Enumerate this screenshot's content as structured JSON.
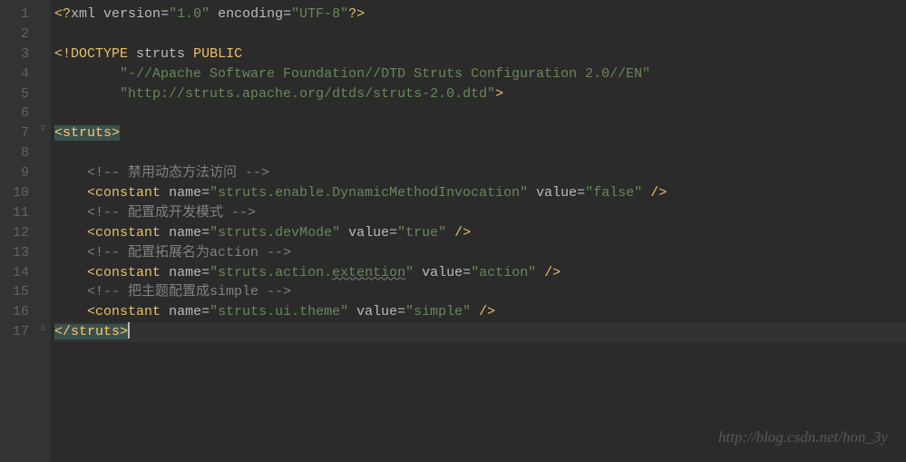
{
  "gutter": {
    "lines": [
      "1",
      "2",
      "3",
      "4",
      "5",
      "6",
      "7",
      "8",
      "9",
      "10",
      "11",
      "12",
      "13",
      "14",
      "15",
      "16",
      "17"
    ]
  },
  "code": {
    "line1": {
      "p1": "<?",
      "p2": "xml version",
      "p3": "=",
      "p4": "\"1.0\"",
      "p5": " encoding",
      "p6": "=",
      "p7": "\"UTF-8\"",
      "p8": "?>"
    },
    "line3": {
      "p1": "<!",
      "p2": "DOCTYPE ",
      "p3": "struts ",
      "p4": "PUBLIC"
    },
    "line4": {
      "indent": "        ",
      "val": "\"-//Apache Software Foundation//DTD Struts Configuration 2.0//EN\""
    },
    "line5": {
      "indent": "        ",
      "val": "\"http://struts.apache.org/dtds/struts-2.0.dtd\"",
      "close": ">"
    },
    "line7": {
      "open": "<",
      "tag": "struts",
      "close": ">"
    },
    "line9": {
      "indent": "    ",
      "comment": "<!-- 禁用动态方法访问 -->"
    },
    "line10": {
      "indent": "    ",
      "open": "<",
      "tag": "constant",
      "attr1": " name",
      "eq": "=",
      "val1": "\"struts.enable.DynamicMethodInvocation\"",
      "attr2": " value",
      "val2": "\"false\"",
      "close": " />"
    },
    "line11": {
      "indent": "    ",
      "comment": "<!-- 配置成开发模式 -->"
    },
    "line12": {
      "indent": "    ",
      "open": "<",
      "tag": "constant",
      "attr1": " name",
      "eq": "=",
      "val1": "\"struts.devMode\"",
      "attr2": " value",
      "val2": "\"true\"",
      "close": " />"
    },
    "line13": {
      "indent": "    ",
      "comment": "<!-- 配置拓展名为action -->"
    },
    "line14": {
      "indent": "    ",
      "open": "<",
      "tag": "constant",
      "attr1": " name",
      "eq": "=",
      "val1a": "\"struts.action.",
      "val1b": "extention",
      "val1c": "\"",
      "attr2": " value",
      "val2": "\"action\"",
      "close": " />"
    },
    "line15": {
      "indent": "    ",
      "comment": "<!-- 把主题配置成simple -->"
    },
    "line16": {
      "indent": "    ",
      "open": "<",
      "tag": "constant",
      "attr1": " name",
      "eq": "=",
      "val1": "\"struts.ui.theme\"",
      "attr2": " value",
      "val2": "\"simple\"",
      "close": " />"
    },
    "line17": {
      "open": "</",
      "tag": "struts",
      "close": ">"
    }
  },
  "watermark": "http://blog.csdn.net/hon_3y"
}
